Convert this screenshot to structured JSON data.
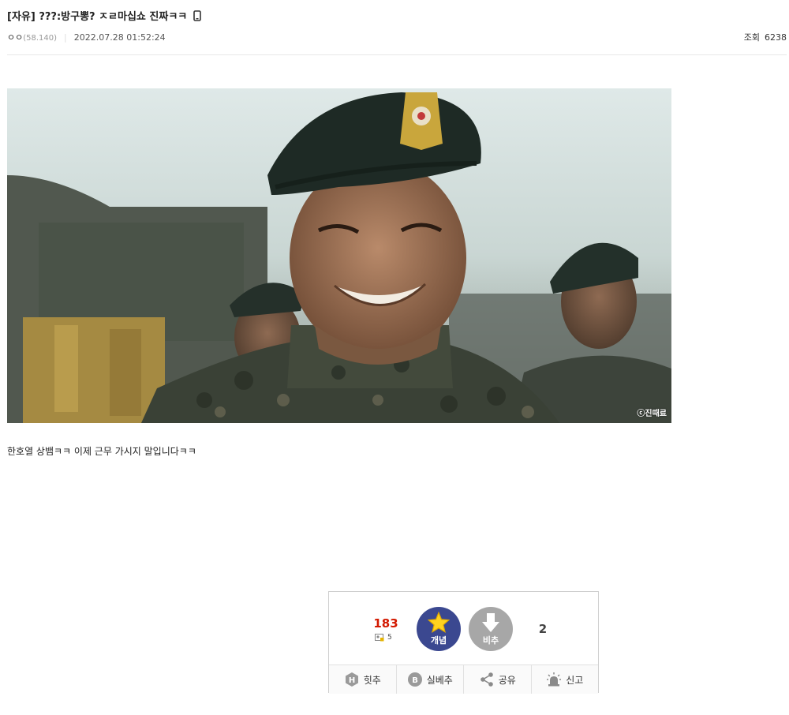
{
  "post": {
    "title": "[자유] ???:방구뽕? ㅈㄹ마십쇼 진짜ㅋㅋ",
    "author_nick": "ㅇㅇ",
    "author_ip": "(58.140)",
    "date": "2022.07.28 01:52:24",
    "views_label": "조회",
    "views_count": "6238",
    "body_text": "한호열 상뱀ㅋㅋ 이제 근무 가시지 말입니다ㅋㅋ",
    "image_watermark": "ⓒ진때료",
    "icons": {
      "title": "mobile-phone-icon",
      "image": "soldier-photo"
    }
  },
  "vote": {
    "up_count": "183",
    "fixed_count": "5",
    "up_label": "개념",
    "down_label": "비추",
    "down_count": "2",
    "accent_up": "#3b4890",
    "accent_down": "#a7a7a7",
    "count_color": "#d31900"
  },
  "actions": {
    "hit": "힛추",
    "real_best": "실베추",
    "share": "공유",
    "report": "신고"
  }
}
